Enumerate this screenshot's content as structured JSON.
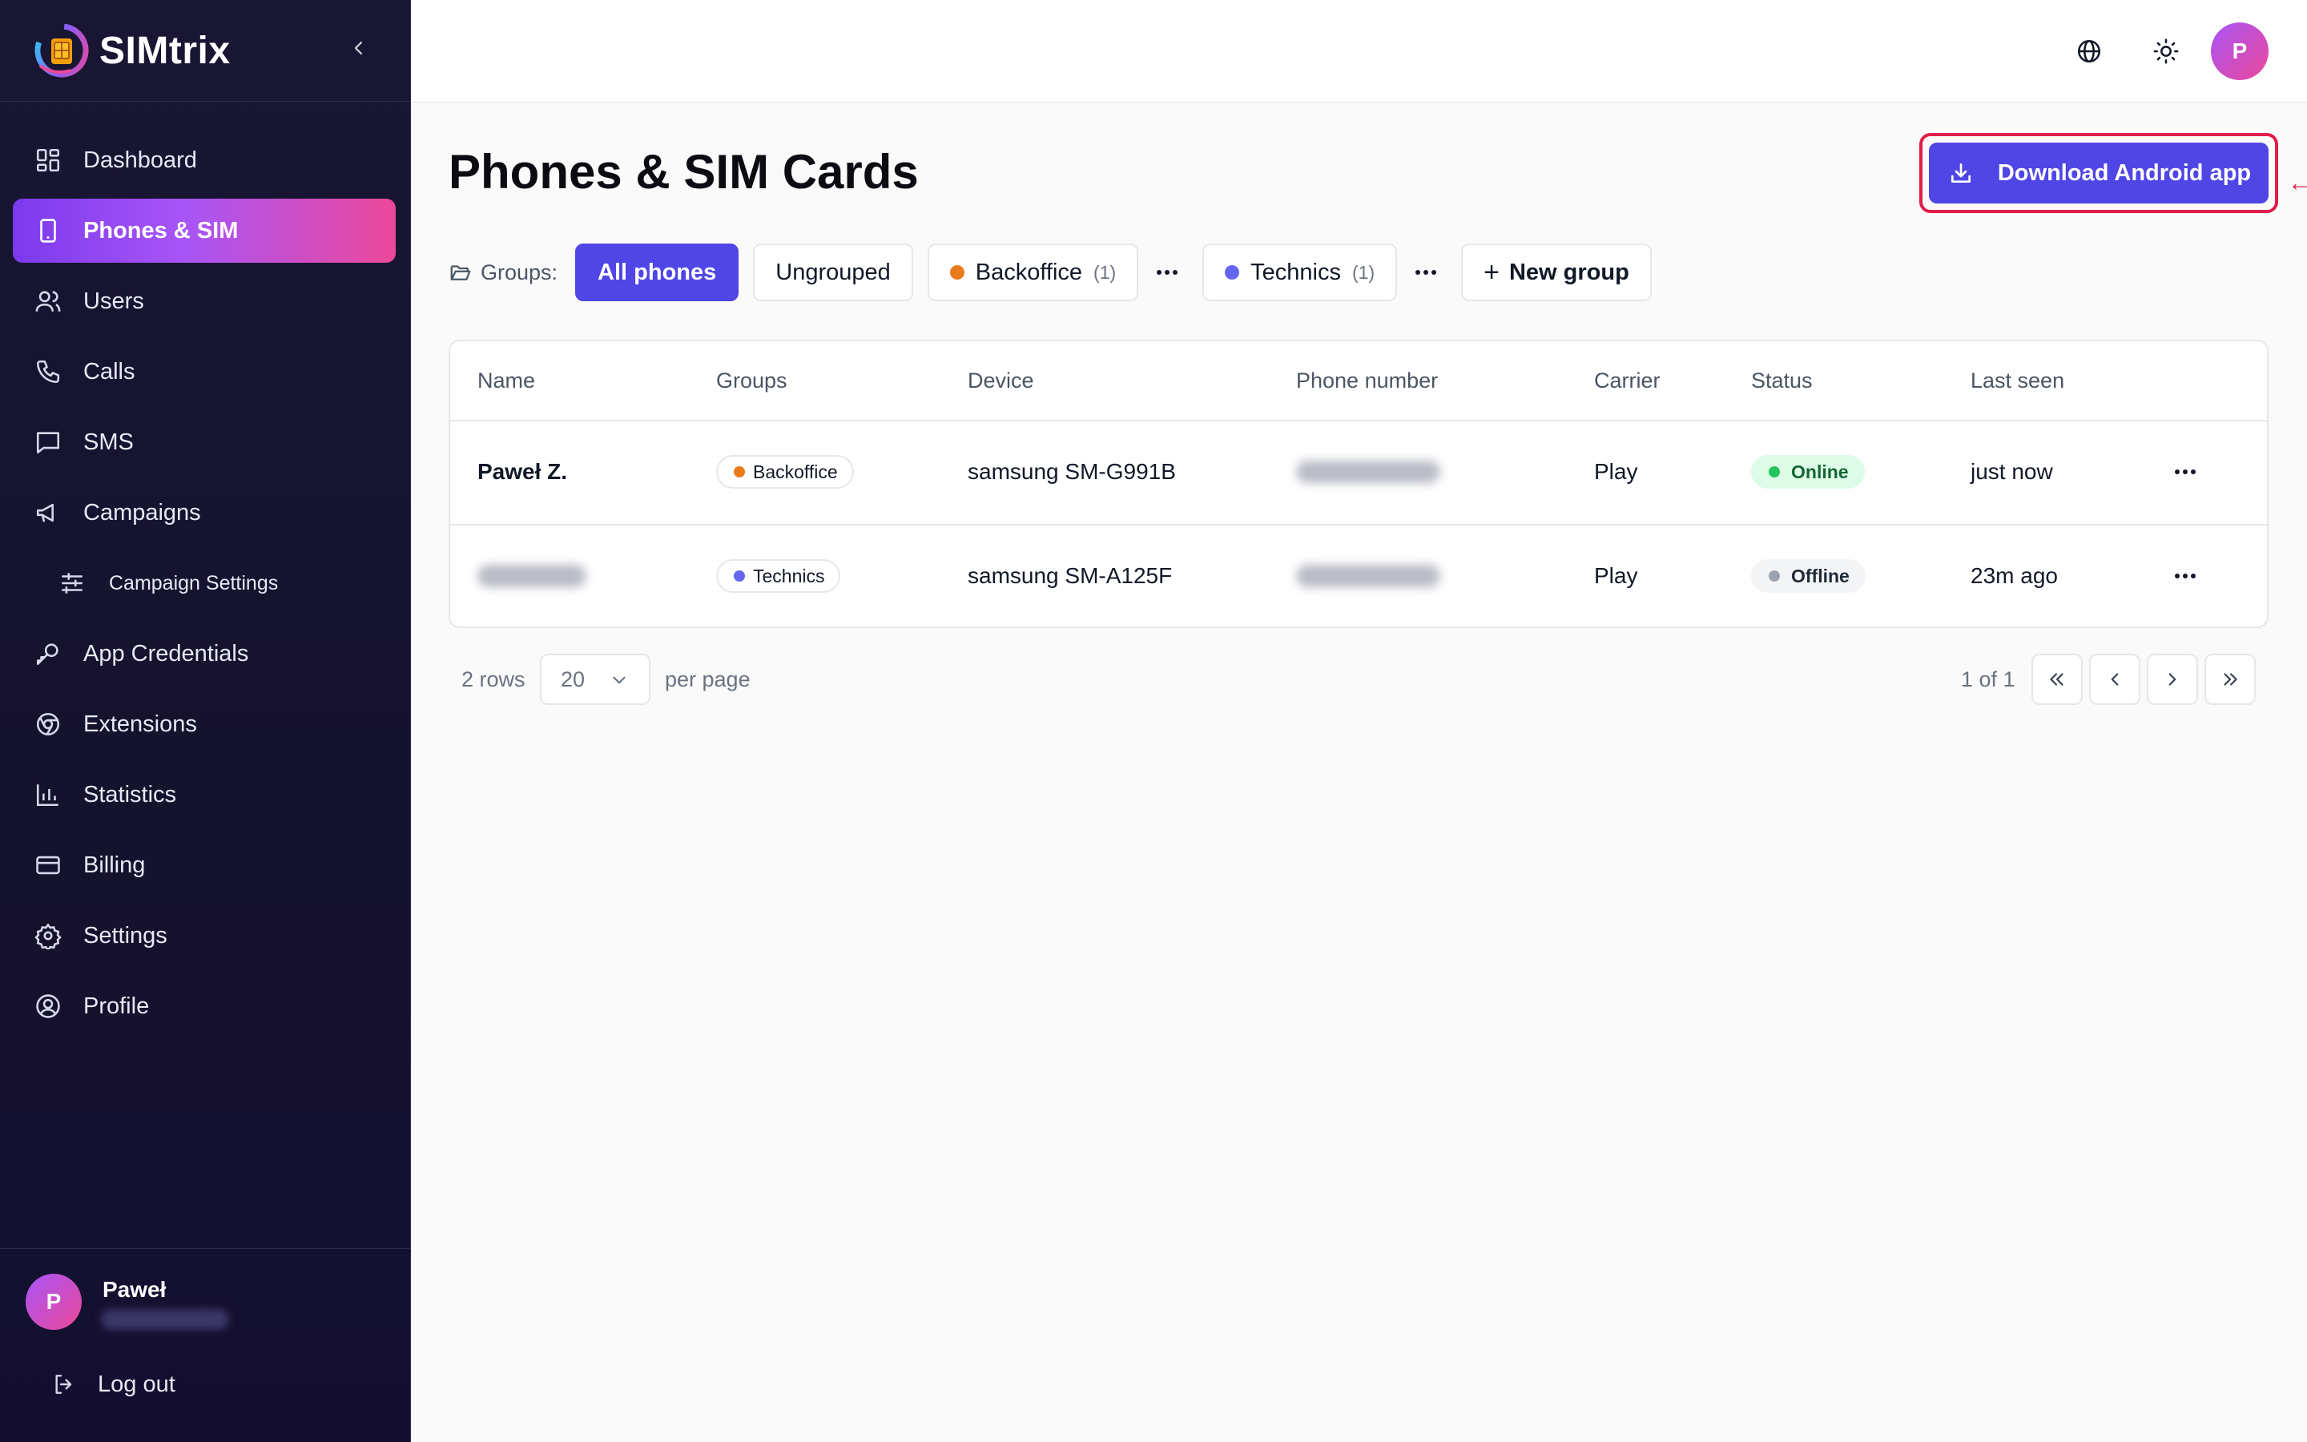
{
  "app": {
    "name": "SIMtrix"
  },
  "sidebar": {
    "items": [
      {
        "label": "Dashboard",
        "icon": "dashboard-icon"
      },
      {
        "label": "Phones & SIM",
        "icon": "smartphone-icon",
        "active": true
      },
      {
        "label": "Users",
        "icon": "users-icon"
      },
      {
        "label": "Calls",
        "icon": "phone-icon"
      },
      {
        "label": "SMS",
        "icon": "message-icon"
      },
      {
        "label": "Campaigns",
        "icon": "megaphone-icon"
      },
      {
        "label": "Campaign Settings",
        "icon": "sliders-icon",
        "sub": true
      },
      {
        "label": "App Credentials",
        "icon": "key-icon"
      },
      {
        "label": "Extensions",
        "icon": "chrome-icon"
      },
      {
        "label": "Statistics",
        "icon": "bar-chart-icon"
      },
      {
        "label": "Billing",
        "icon": "credit-card-icon"
      },
      {
        "label": "Settings",
        "icon": "gear-icon"
      },
      {
        "label": "Profile",
        "icon": "user-circle-icon"
      }
    ],
    "user": {
      "initial": "P",
      "name": "Paweł"
    },
    "logout_label": "Log out"
  },
  "topbar": {
    "avatar_initial": "P"
  },
  "page": {
    "title": "Phones & SIM Cards",
    "download_button": "Download Android app"
  },
  "groups": {
    "label": "Groups:",
    "all": "All phones",
    "ungrouped": "Ungrouped",
    "items": [
      {
        "name": "Backoffice",
        "count": "(1)",
        "color": "#ea7a1c"
      },
      {
        "name": "Technics",
        "count": "(1)",
        "color": "#6366f1"
      }
    ],
    "new_group": "New group"
  },
  "table": {
    "columns": [
      "Name",
      "Groups",
      "Device",
      "Phone number",
      "Carrier",
      "Status",
      "Last seen"
    ],
    "rows": [
      {
        "name": "Paweł Z.",
        "group": "Backoffice",
        "group_color": "#ea7a1c",
        "device": "samsung SM-G991B",
        "carrier": "Play",
        "status": "Online",
        "status_color": "#22c55e",
        "last_seen": "just now"
      },
      {
        "name": "",
        "group": "Technics",
        "group_color": "#6366f1",
        "device": "samsung SM-A125F",
        "carrier": "Play",
        "status": "Offline",
        "status_color": "#9ca3af",
        "last_seen": "23m ago"
      }
    ]
  },
  "pagination": {
    "rows_count": "2 rows",
    "per_page_value": "20",
    "per_page_label": "per page",
    "page_info": "1 of 1"
  },
  "colors": {
    "accent": "#4f46e5",
    "highlight_outline": "#e11d48",
    "sidebar_bg": "#171432"
  }
}
